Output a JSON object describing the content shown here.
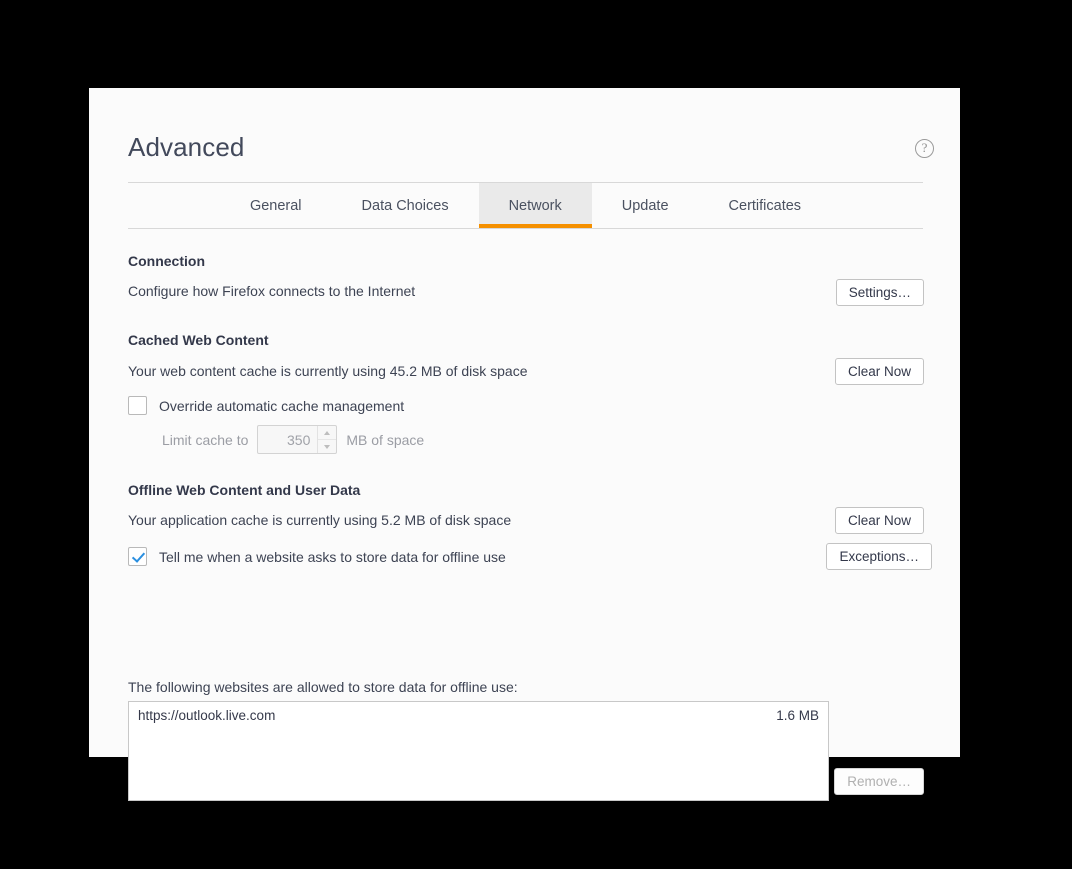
{
  "header": {
    "title": "Advanced",
    "help_icon": "help-circle-icon",
    "help_glyph": "?"
  },
  "tabs": [
    {
      "label": "General",
      "selected": false
    },
    {
      "label": "Data Choices",
      "selected": false
    },
    {
      "label": "Network",
      "selected": true
    },
    {
      "label": "Update",
      "selected": false
    },
    {
      "label": "Certificates",
      "selected": false
    }
  ],
  "connection": {
    "heading": "Connection",
    "description": "Configure how Firefox connects to the Internet",
    "settings_button": "Settings…"
  },
  "cached_web_content": {
    "heading": "Cached Web Content",
    "usage_text": "Your web content cache is currently using 45.2 MB of disk space",
    "clear_button": "Clear Now",
    "override_checkbox_label": "Override automatic cache management",
    "override_checked": false,
    "limit_label": "Limit cache to",
    "limit_value": "350",
    "limit_suffix": "MB of space"
  },
  "offline_web_content": {
    "heading": "Offline Web Content and User Data",
    "usage_text": "Your application cache is currently using 5.2 MB of disk space",
    "clear_button": "Clear Now",
    "notify_checkbox_label": "Tell me when a website asks to store data for offline use",
    "notify_checked": true,
    "exceptions_button": "Exceptions…",
    "list_caption": "The following websites are allowed to store data for offline use:",
    "sites": [
      {
        "url": "https://outlook.live.com",
        "size": "1.6 MB"
      }
    ],
    "remove_button": "Remove…",
    "remove_disabled": true
  },
  "colors": {
    "accent_orange": "#f59000",
    "checkbox_blue": "#2a8fe0",
    "panel_bg": "#fbfbfb",
    "text_dark": "#33384a",
    "backdrop": "#000000"
  }
}
